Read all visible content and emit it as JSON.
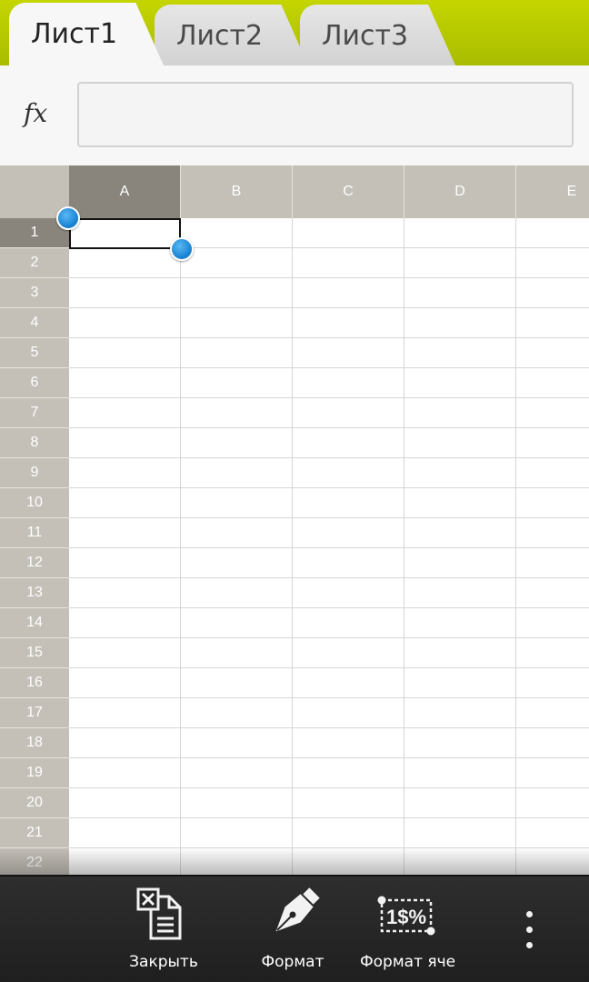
{
  "tabs": [
    {
      "label": "Лист1",
      "active": true
    },
    {
      "label": "Лист2",
      "active": false
    },
    {
      "label": "Лист3",
      "active": false
    }
  ],
  "formula_bar": {
    "icon_label": "fx",
    "value": ""
  },
  "grid": {
    "columns": [
      "A",
      "B",
      "C",
      "D",
      "E"
    ],
    "rows": [
      "1",
      "2",
      "3",
      "4",
      "5",
      "6",
      "7",
      "8",
      "9",
      "10",
      "11",
      "12",
      "13",
      "14",
      "15",
      "16",
      "17",
      "18",
      "19",
      "20",
      "21",
      "22"
    ],
    "selected_cell": {
      "column": "A",
      "row": "1"
    }
  },
  "actions": {
    "close_label": "Закрыть",
    "format_label": "Формат",
    "cell_format_label": "Формат яче",
    "close_icon": "close-document-icon",
    "format_icon": "pen-nib-icon",
    "cell_format_icon": "cell-format-icon",
    "overflow_icon": "overflow-menu-icon"
  },
  "colors": {
    "tabbar_accent": "#b4c800",
    "header_bg": "#c4bfb7",
    "header_selected": "#8a857c",
    "selection_handle": "#1d87d6",
    "actionbar_bg": "#262626"
  }
}
